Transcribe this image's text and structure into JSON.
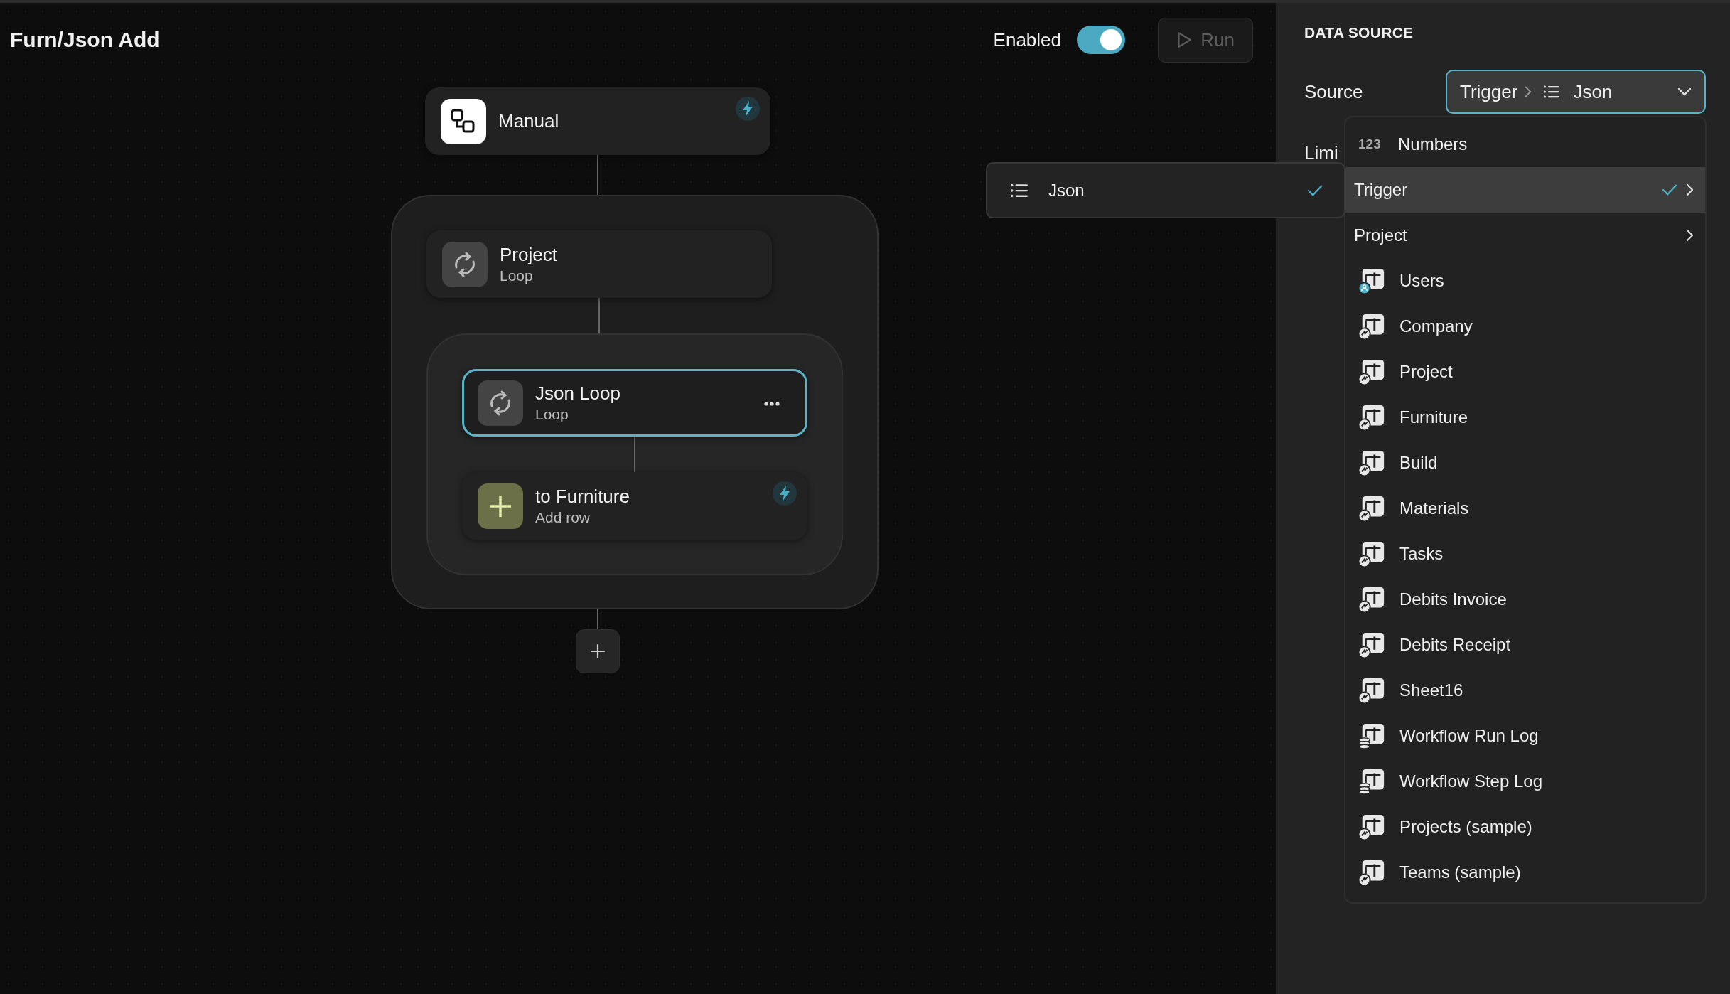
{
  "canvas": {
    "title": "Furn/Json Add",
    "enabled": {
      "label": "Enabled",
      "on": true
    },
    "run_button": {
      "label": "Run",
      "disabled": true
    },
    "flow": [
      {
        "kind": "trigger",
        "title": "Manual",
        "lightning": true,
        "selected": false
      },
      {
        "kind": "loop",
        "title": "Project",
        "subtitle": "Loop",
        "lightning": false,
        "selected": false,
        "children": [
          {
            "kind": "loop",
            "title": "Json Loop",
            "subtitle": "Loop",
            "lightning": false,
            "selected": true,
            "children": [
              {
                "kind": "add_row",
                "title": "to Furniture",
                "subtitle": "Add row",
                "lightning": true,
                "selected": false
              }
            ]
          }
        ]
      }
    ]
  },
  "submenu": {
    "items": [
      {
        "label": "Json",
        "kind": "list",
        "selected": true
      }
    ]
  },
  "panel": {
    "heading": "DATA SOURCE",
    "source": {
      "label": "Source",
      "path": [
        {
          "label": "Trigger",
          "kind": "folder"
        },
        {
          "label": "Json",
          "kind": "list"
        }
      ]
    },
    "limit_label": "Limi",
    "dropdown": {
      "items": [
        {
          "kind": "numbers",
          "icon_text": "123",
          "label": "Numbers",
          "selected": false,
          "has_children": false
        },
        {
          "kind": "folder",
          "label": "Trigger",
          "selected": true,
          "has_children": true
        },
        {
          "kind": "folder",
          "label": "Project",
          "selected": false,
          "has_children": true
        },
        {
          "kind": "user_table",
          "label": "Users",
          "selected": false,
          "has_children": false
        },
        {
          "kind": "synced_table",
          "label": "Company",
          "selected": false,
          "has_children": false
        },
        {
          "kind": "synced_table",
          "label": "Project",
          "selected": false,
          "has_children": false
        },
        {
          "kind": "synced_table",
          "label": "Furniture",
          "selected": false,
          "has_children": false
        },
        {
          "kind": "synced_table",
          "label": "Build",
          "selected": false,
          "has_children": false
        },
        {
          "kind": "synced_table",
          "label": "Materials",
          "selected": false,
          "has_children": false
        },
        {
          "kind": "synced_table",
          "label": "Tasks",
          "selected": false,
          "has_children": false
        },
        {
          "kind": "synced_table",
          "label": "Debits Invoice",
          "selected": false,
          "has_children": false
        },
        {
          "kind": "synced_table",
          "label": "Debits Receipt",
          "selected": false,
          "has_children": false
        },
        {
          "kind": "synced_table",
          "label": "Sheet16",
          "selected": false,
          "has_children": false
        },
        {
          "kind": "database_table",
          "label": "Workflow Run Log",
          "selected": false,
          "has_children": false
        },
        {
          "kind": "database_table",
          "label": "Workflow Step Log",
          "selected": false,
          "has_children": false
        },
        {
          "kind": "synced_table",
          "label": "Projects (sample)",
          "selected": false,
          "has_children": false
        },
        {
          "kind": "synced_table",
          "label": "Teams (sample)",
          "selected": false,
          "has_children": false
        }
      ]
    }
  }
}
